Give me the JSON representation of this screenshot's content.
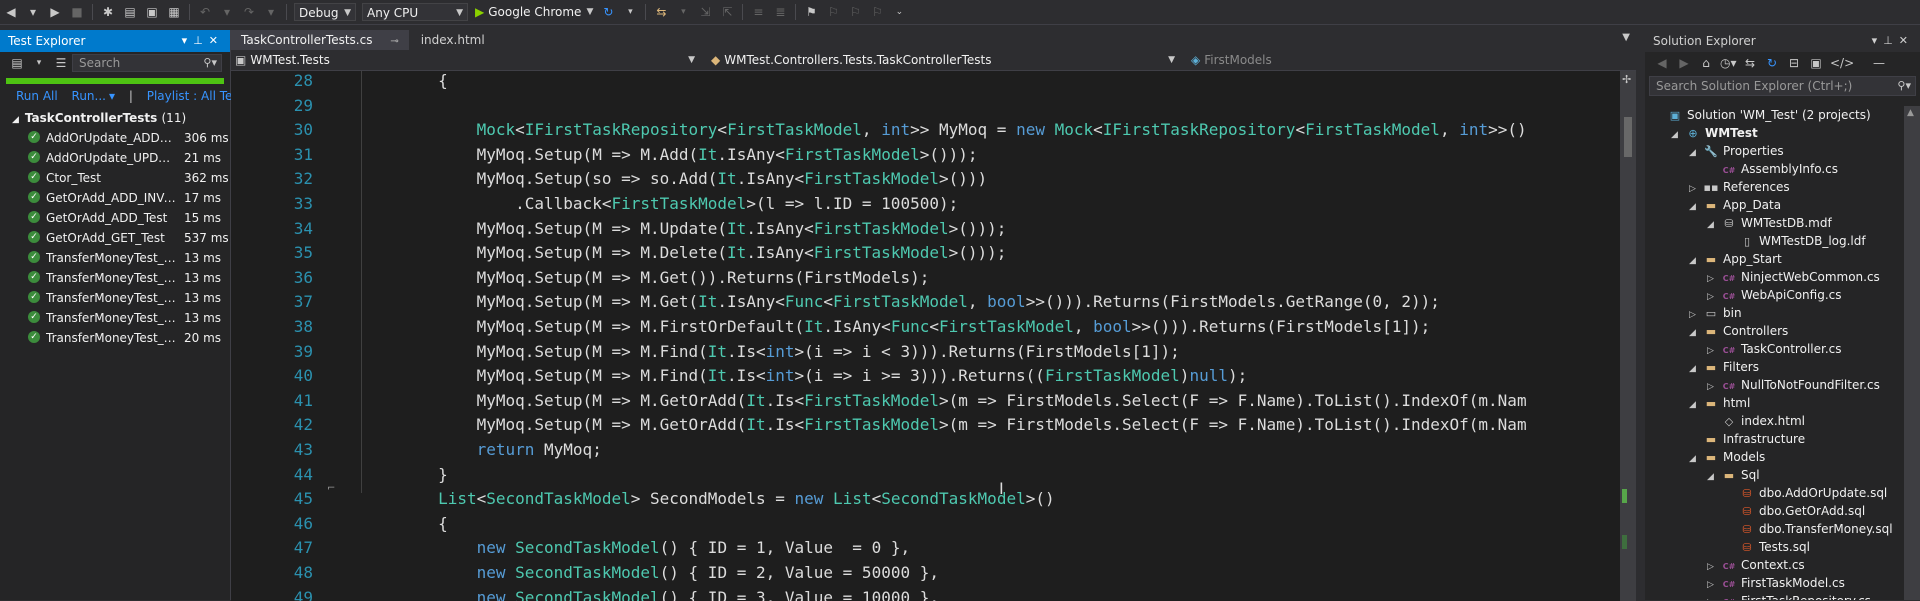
{
  "toolbar": {
    "config": "Debug",
    "platform": "Any CPU",
    "browser": "Google Chrome"
  },
  "test_explorer": {
    "title": "Test Explorer",
    "search_placeholder": "Search",
    "progress_state": "passed",
    "run_all": "Run All",
    "run_menu": "Run...",
    "playlist": "Playlist : All Tests",
    "group": "TaskControllerTests",
    "group_count": "(11)",
    "tests": [
      {
        "name": "AddOrUpdate_ADD_Test",
        "duration": "306 ms"
      },
      {
        "name": "AddOrUpdate_UPDATE_T...",
        "duration": "21 ms"
      },
      {
        "name": "Ctor_Test",
        "duration": "362 ms"
      },
      {
        "name": "GetOrAdd_ADD_INVALID...",
        "duration": "17 ms"
      },
      {
        "name": "GetOrAdd_ADD_Test",
        "duration": "15 ms"
      },
      {
        "name": "GetOrAdd_GET_Test",
        "duration": "537 ms"
      },
      {
        "name": "TransferMoneyTest_Desti...",
        "duration": "13 ms"
      },
      {
        "name": "TransferMoneyTest_Inter...",
        "duration": "13 ms"
      },
      {
        "name": "TransferMoneyTest_NotE...",
        "duration": "13 ms"
      },
      {
        "name": "TransferMoneyTest_OK",
        "duration": "13 ms"
      },
      {
        "name": "TransferMoneyTest_Sour...",
        "duration": "20 ms"
      }
    ]
  },
  "editor": {
    "tabs": [
      {
        "label": "TaskControllerTests.cs",
        "active": true
      },
      {
        "label": "index.html",
        "active": false
      }
    ],
    "nav_project": "WMTest.Tests",
    "nav_class": "WMTest.Controllers.Tests.TaskControllerTests",
    "nav_member": "FirstModels",
    "lines": [
      {
        "num": "28",
        "tokens": [
          [
            "p",
            "        {"
          ]
        ]
      },
      {
        "num": "29",
        "tokens": [
          [
            "p",
            ""
          ]
        ]
      },
      {
        "num": "30",
        "tokens": [
          [
            "p",
            "            "
          ],
          [
            "t",
            "Mock"
          ],
          [
            "p",
            "<"
          ],
          [
            "t",
            "IFirstTaskRepository"
          ],
          [
            "p",
            "<"
          ],
          [
            "t",
            "FirstTaskModel"
          ],
          [
            "p",
            ", "
          ],
          [
            "k",
            "int"
          ],
          [
            "p",
            ">> MyMoq = "
          ],
          [
            "k",
            "new"
          ],
          [
            "p",
            " "
          ],
          [
            "t",
            "Mock"
          ],
          [
            "p",
            "<"
          ],
          [
            "t",
            "IFirstTaskRepository"
          ],
          [
            "p",
            "<"
          ],
          [
            "t",
            "FirstTaskModel"
          ],
          [
            "p",
            ", "
          ],
          [
            "k",
            "int"
          ],
          [
            "p",
            ">>()"
          ]
        ]
      },
      {
        "num": "31",
        "tokens": [
          [
            "p",
            "            MyMoq.Setup(M => M.Add("
          ],
          [
            "t",
            "It"
          ],
          [
            "p",
            ".IsAny<"
          ],
          [
            "t",
            "FirstTaskModel"
          ],
          [
            "p",
            ">()));"
          ]
        ]
      },
      {
        "num": "32",
        "tokens": [
          [
            "p",
            "            MyMoq.Setup(so => so.Add("
          ],
          [
            "t",
            "It"
          ],
          [
            "p",
            ".IsAny<"
          ],
          [
            "t",
            "FirstTaskModel"
          ],
          [
            "p",
            ">()))"
          ]
        ]
      },
      {
        "num": "33",
        "tokens": [
          [
            "p",
            "                .Callback<"
          ],
          [
            "t",
            "FirstTaskModel"
          ],
          [
            "p",
            ">(l => l.ID = 100500);"
          ]
        ]
      },
      {
        "num": "34",
        "tokens": [
          [
            "p",
            "            MyMoq.Setup(M => M.Update("
          ],
          [
            "t",
            "It"
          ],
          [
            "p",
            ".IsAny<"
          ],
          [
            "t",
            "FirstTaskModel"
          ],
          [
            "p",
            ">()));"
          ]
        ]
      },
      {
        "num": "35",
        "tokens": [
          [
            "p",
            "            MyMoq.Setup(M => M.Delete("
          ],
          [
            "t",
            "It"
          ],
          [
            "p",
            ".IsAny<"
          ],
          [
            "t",
            "FirstTaskModel"
          ],
          [
            "p",
            ">()));"
          ]
        ]
      },
      {
        "num": "36",
        "tokens": [
          [
            "p",
            "            MyMoq.Setup(M => M.Get()).Returns(FirstModels);"
          ]
        ]
      },
      {
        "num": "37",
        "tokens": [
          [
            "p",
            "            MyMoq.Setup(M => M.Get("
          ],
          [
            "t",
            "It"
          ],
          [
            "p",
            ".IsAny<"
          ],
          [
            "t",
            "Func"
          ],
          [
            "p",
            "<"
          ],
          [
            "t",
            "FirstTaskModel"
          ],
          [
            "p",
            ", "
          ],
          [
            "k",
            "bool"
          ],
          [
            "p",
            ">>())).Returns(FirstModels.GetRange(0, 2));"
          ]
        ]
      },
      {
        "num": "38",
        "tokens": [
          [
            "p",
            "            MyMoq.Setup(M => M.FirstOrDefault("
          ],
          [
            "t",
            "It"
          ],
          [
            "p",
            ".IsAny<"
          ],
          [
            "t",
            "Func"
          ],
          [
            "p",
            "<"
          ],
          [
            "t",
            "FirstTaskModel"
          ],
          [
            "p",
            ", "
          ],
          [
            "k",
            "bool"
          ],
          [
            "p",
            ">>())).Returns(FirstModels[1]);"
          ]
        ]
      },
      {
        "num": "39",
        "tokens": [
          [
            "p",
            "            MyMoq.Setup(M => M.Find("
          ],
          [
            "t",
            "It"
          ],
          [
            "p",
            ".Is<"
          ],
          [
            "k",
            "int"
          ],
          [
            "p",
            ">(i => i < 3))).Returns(FirstModels[1]);"
          ]
        ]
      },
      {
        "num": "40",
        "tokens": [
          [
            "p",
            "            MyMoq.Setup(M => M.Find("
          ],
          [
            "t",
            "It"
          ],
          [
            "p",
            ".Is<"
          ],
          [
            "k",
            "int"
          ],
          [
            "p",
            ">(i => i >= 3))).Returns(("
          ],
          [
            "t",
            "FirstTaskModel"
          ],
          [
            "p",
            ")"
          ],
          [
            "k",
            "null"
          ],
          [
            "p",
            ");"
          ]
        ]
      },
      {
        "num": "41",
        "tokens": [
          [
            "p",
            "            MyMoq.Setup(M => M.GetOrAdd("
          ],
          [
            "t",
            "It"
          ],
          [
            "p",
            ".Is<"
          ],
          [
            "t",
            "FirstTaskModel"
          ],
          [
            "p",
            ">(m => FirstModels.Select(F => F.Name).ToList().IndexOf(m.Nam"
          ]
        ]
      },
      {
        "num": "42",
        "tokens": [
          [
            "p",
            "            MyMoq.Setup(M => M.GetOrAdd("
          ],
          [
            "t",
            "It"
          ],
          [
            "p",
            ".Is<"
          ],
          [
            "t",
            "FirstTaskModel"
          ],
          [
            "p",
            ">(m => FirstModels.Select(F => F.Name).ToList().IndexOf(m.Nam"
          ]
        ]
      },
      {
        "num": "43",
        "tokens": [
          [
            "p",
            "            "
          ],
          [
            "k",
            "return"
          ],
          [
            "p",
            " MyMoq;"
          ]
        ]
      },
      {
        "num": "44",
        "tokens": [
          [
            "p",
            "        }"
          ]
        ]
      },
      {
        "num": "45",
        "tokens": [
          [
            "p",
            "        "
          ],
          [
            "t",
            "List"
          ],
          [
            "p",
            "<"
          ],
          [
            "t",
            "SecondTaskModel"
          ],
          [
            "p",
            "> SecondModels = "
          ],
          [
            "k",
            "new"
          ],
          [
            "p",
            " "
          ],
          [
            "t",
            "List"
          ],
          [
            "p",
            "<"
          ],
          [
            "t",
            "SecondTaskModel"
          ],
          [
            "p",
            ">()"
          ]
        ]
      },
      {
        "num": "46",
        "tokens": [
          [
            "p",
            "        {"
          ]
        ]
      },
      {
        "num": "47",
        "tokens": [
          [
            "p",
            "            "
          ],
          [
            "k",
            "new"
          ],
          [
            "p",
            " "
          ],
          [
            "t",
            "SecondTaskModel"
          ],
          [
            "p",
            "() { ID = 1, Value  = 0 },"
          ]
        ]
      },
      {
        "num": "48",
        "tokens": [
          [
            "p",
            "            "
          ],
          [
            "k",
            "new"
          ],
          [
            "p",
            " "
          ],
          [
            "t",
            "SecondTaskModel"
          ],
          [
            "p",
            "() { ID = 2, Value = 50000 },"
          ]
        ]
      },
      {
        "num": "49",
        "tokens": [
          [
            "p",
            "            "
          ],
          [
            "k",
            "new"
          ],
          [
            "p",
            " "
          ],
          [
            "t",
            "SecondTaskModel"
          ],
          [
            "p",
            "() { ID = 3, Value = 10000 },"
          ]
        ]
      }
    ]
  },
  "solution_explorer": {
    "title": "Solution Explorer",
    "search_placeholder": "Search Solution Explorer (Ctrl+;)",
    "items": [
      {
        "label": "Solution 'WM_Test' (2 projects)",
        "depth": 0,
        "exp": "",
        "icon": "solution",
        "bold": false
      },
      {
        "label": "WMTest",
        "depth": 1,
        "exp": "open",
        "icon": "project",
        "bold": true
      },
      {
        "label": "Properties",
        "depth": 2,
        "exp": "open",
        "icon": "wrench",
        "bold": false
      },
      {
        "label": "AssemblyInfo.cs",
        "depth": 3,
        "exp": "",
        "icon": "csfile",
        "bold": false
      },
      {
        "label": "References",
        "depth": 2,
        "exp": "closed",
        "icon": "references",
        "bold": false
      },
      {
        "label": "App_Data",
        "depth": 2,
        "exp": "open",
        "icon": "folder",
        "bold": false
      },
      {
        "label": "WMTestDB.mdf",
        "depth": 3,
        "exp": "open",
        "icon": "database",
        "bold": false
      },
      {
        "label": "WMTestDB_log.ldf",
        "depth": 4,
        "exp": "",
        "icon": "file",
        "bold": false
      },
      {
        "label": "App_Start",
        "depth": 2,
        "exp": "open",
        "icon": "folder",
        "bold": false
      },
      {
        "label": "NinjectWebCommon.cs",
        "depth": 3,
        "exp": "closed",
        "icon": "csfile",
        "bold": false
      },
      {
        "label": "WebApiConfig.cs",
        "depth": 3,
        "exp": "closed",
        "icon": "csfile",
        "bold": false
      },
      {
        "label": "bin",
        "depth": 2,
        "exp": "closed",
        "icon": "folder-outline",
        "bold": false
      },
      {
        "label": "Controllers",
        "depth": 2,
        "exp": "open",
        "icon": "folder",
        "bold": false
      },
      {
        "label": "TaskController.cs",
        "depth": 3,
        "exp": "closed",
        "icon": "csfile",
        "bold": false
      },
      {
        "label": "Filters",
        "depth": 2,
        "exp": "open",
        "icon": "folder",
        "bold": false
      },
      {
        "label": "NullToNotFoundFilter.cs",
        "depth": 3,
        "exp": "closed",
        "icon": "csfile",
        "bold": false
      },
      {
        "label": "html",
        "depth": 2,
        "exp": "open",
        "icon": "folder",
        "bold": false
      },
      {
        "label": "index.html",
        "depth": 3,
        "exp": "",
        "icon": "htmlfile",
        "bold": false
      },
      {
        "label": "Infrastructure",
        "depth": 2,
        "exp": "",
        "icon": "folder",
        "bold": false
      },
      {
        "label": "Models",
        "depth": 2,
        "exp": "open",
        "icon": "folder",
        "bold": false
      },
      {
        "label": "Sql",
        "depth": 3,
        "exp": "open",
        "icon": "folder",
        "bold": false
      },
      {
        "label": "dbo.AddOrUpdate.sql",
        "depth": 4,
        "exp": "",
        "icon": "sqlfile",
        "bold": false
      },
      {
        "label": "dbo.GetOrAdd.sql",
        "depth": 4,
        "exp": "",
        "icon": "sqlfile",
        "bold": false
      },
      {
        "label": "dbo.TransferMoney.sql",
        "depth": 4,
        "exp": "",
        "icon": "sqlfile",
        "bold": false
      },
      {
        "label": "Tests.sql",
        "depth": 4,
        "exp": "",
        "icon": "sqlfile",
        "bold": false
      },
      {
        "label": "Context.cs",
        "depth": 3,
        "exp": "closed",
        "icon": "csfile",
        "bold": false
      },
      {
        "label": "FirstTaskModel.cs",
        "depth": 3,
        "exp": "closed",
        "icon": "csfile",
        "bold": false
      },
      {
        "label": "FirstTaskRepository.cs",
        "depth": 3,
        "exp": "closed",
        "icon": "csfile",
        "bold": false
      }
    ]
  },
  "colors": {
    "accent": "#007acc",
    "pass": "#3c8c3c",
    "progress": "#4ec312",
    "keyword": "#569cd6",
    "type": "#4ec9b0",
    "line_number": "#2b91af"
  }
}
